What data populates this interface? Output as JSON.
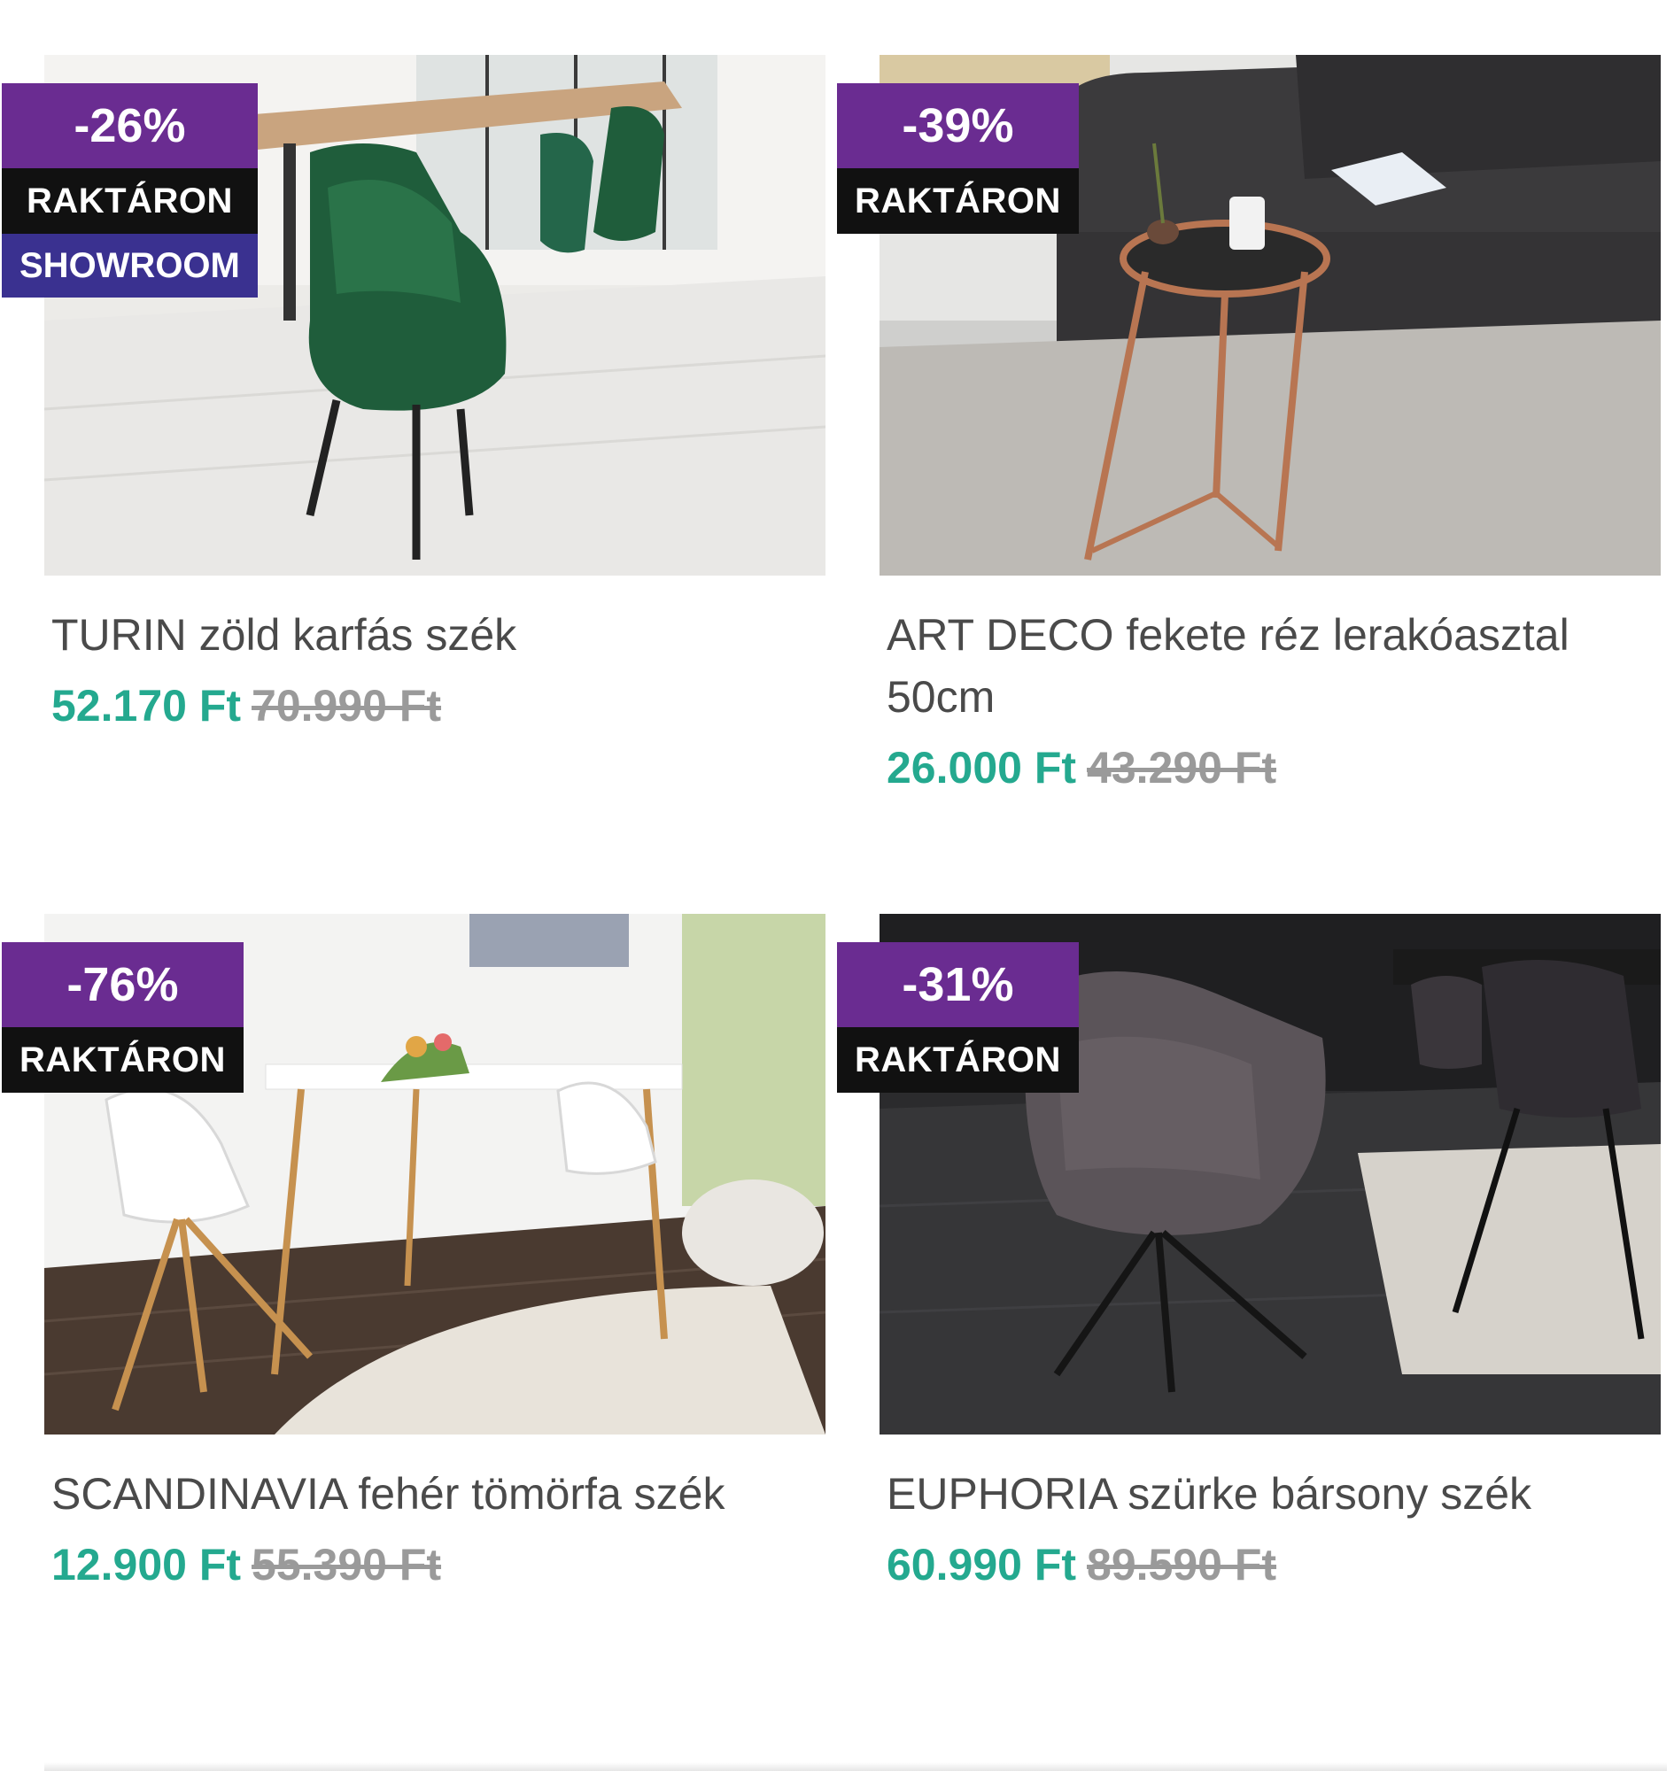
{
  "products": [
    {
      "title": "TURIN zöld karfás szék",
      "price": "52.170 Ft",
      "old_price": "70.990 Ft",
      "badges": {
        "discount": "-26%",
        "stock": "RAKTÁRON",
        "showroom": "SHOWROOM"
      }
    },
    {
      "title": "ART DECO fekete réz lerakóasztal 50cm",
      "price": "26.000 Ft",
      "old_price": "43.290 Ft",
      "badges": {
        "discount": "-39%",
        "stock": "RAKTÁRON"
      }
    },
    {
      "title": "SCANDINAVIA fehér tömörfa szék",
      "price": "12.900 Ft",
      "old_price": "55.390 Ft",
      "badges": {
        "discount": "-76%",
        "stock": "RAKTÁRON"
      }
    },
    {
      "title": "EUPHORIA szürke bársony szék",
      "price": "60.990 Ft",
      "old_price": "89.590 Ft",
      "badges": {
        "discount": "-31%",
        "stock": "RAKTÁRON"
      }
    }
  ],
  "colors": {
    "discount_badge": "#6a2c91",
    "stock_badge": "#111111",
    "showroom_badge": "#3a3190",
    "price": "#24a98f",
    "old_price": "#9a9a9a",
    "title": "#4a4a4a"
  }
}
